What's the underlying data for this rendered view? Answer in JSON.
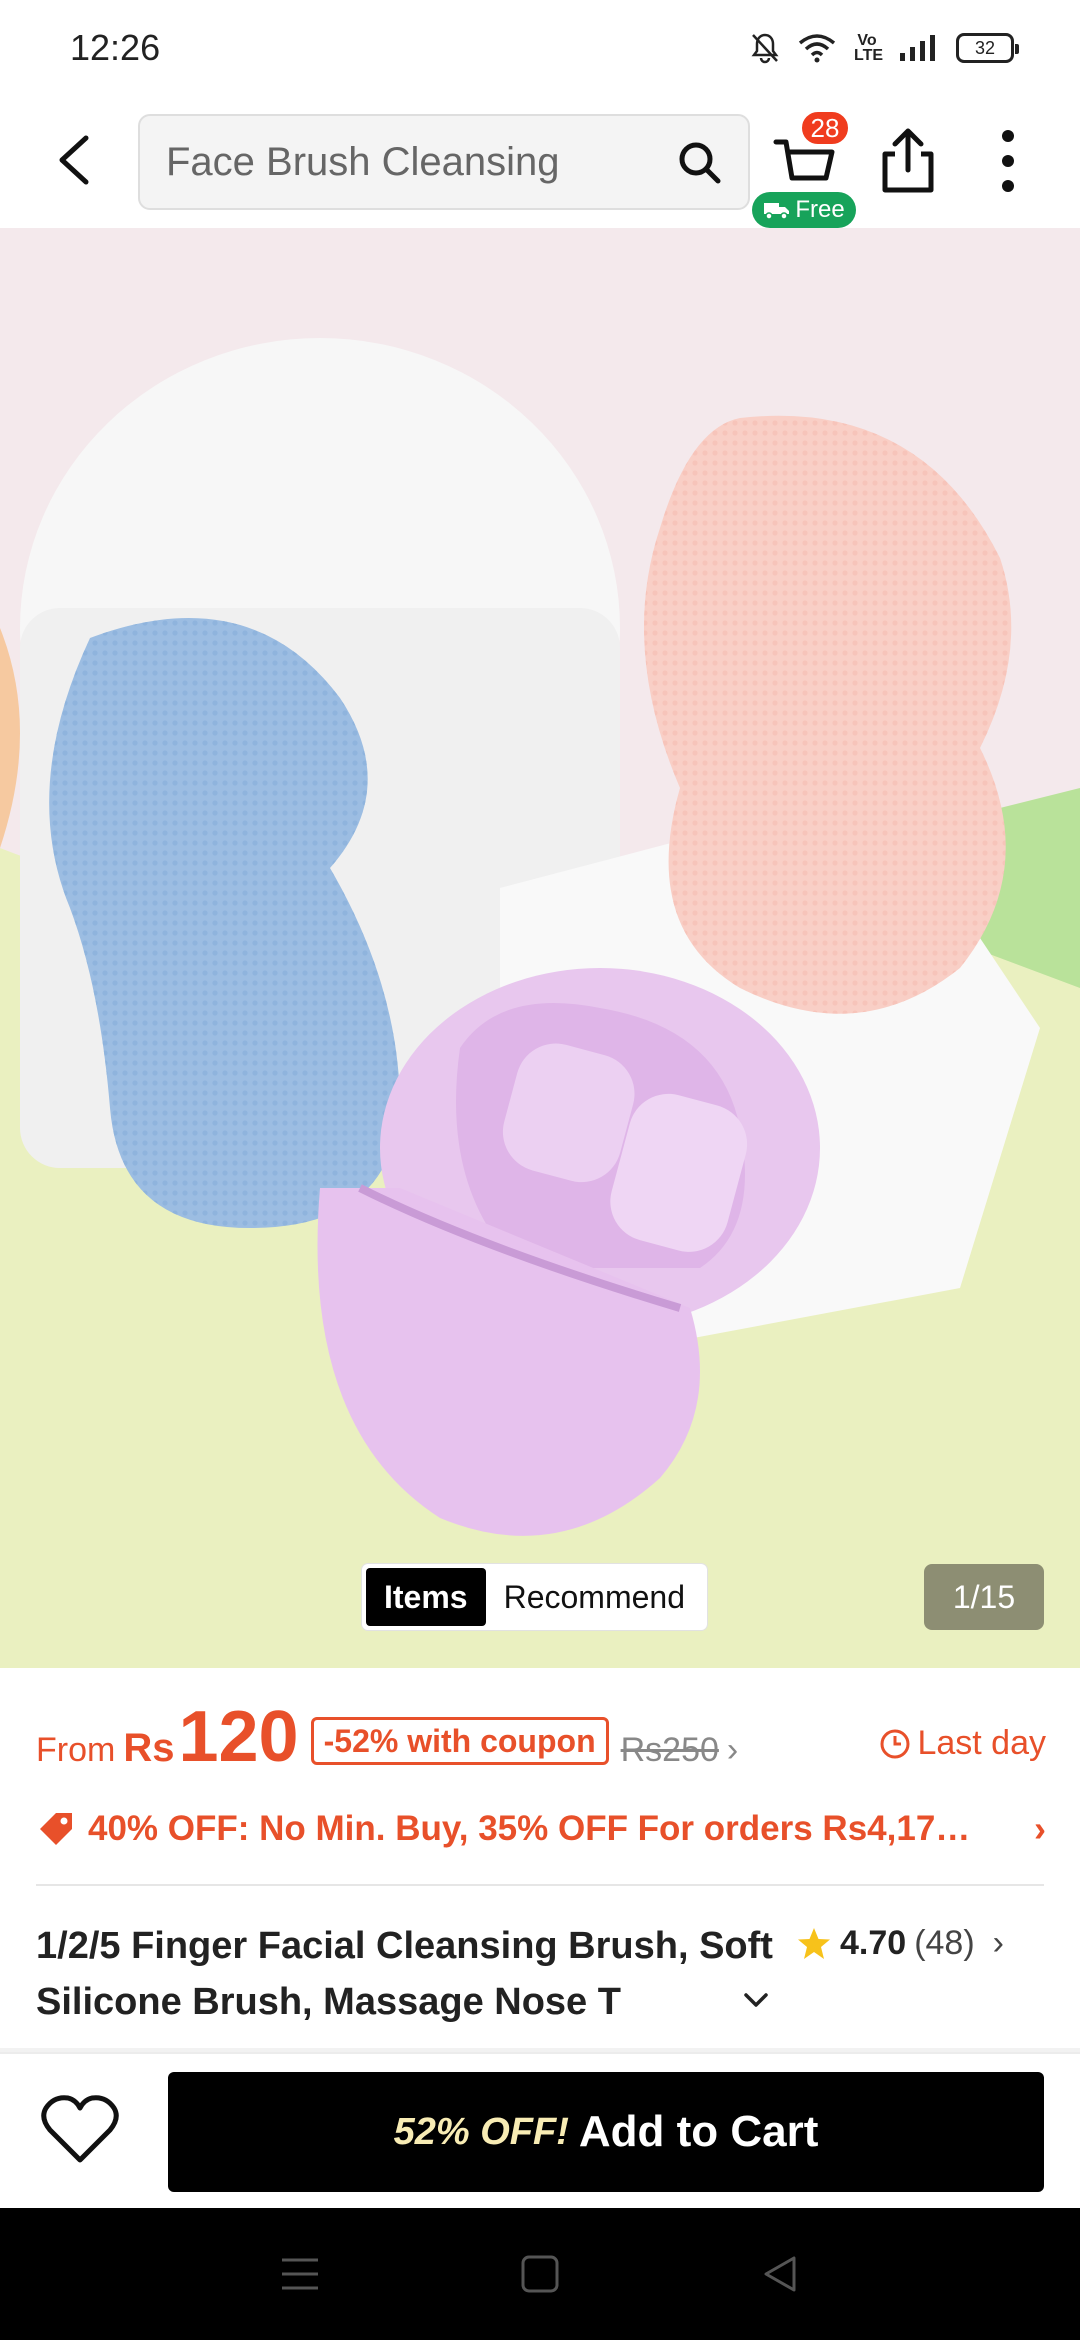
{
  "status_bar": {
    "time": "12:26",
    "network": "Vo LTE",
    "battery": "32"
  },
  "header": {
    "search_text": "Face Brush Cleansing",
    "cart_count": "28",
    "cart_free_label": "Free"
  },
  "hero": {
    "tab_items": "Items",
    "tab_recommend": "Recommend",
    "counter": "1/15"
  },
  "price": {
    "from_label": "From",
    "currency": "Rs",
    "value": "120",
    "coupon": "-52% with coupon",
    "original": "Rs250",
    "last_day": "Last day"
  },
  "promo": {
    "text": "40% OFF: No Min. Buy,  35% OFF For orders Rs4,17…"
  },
  "product": {
    "title": "1/2/5 Finger Facial Cleansing Brush, Soft Silicone Brush, Massage Nose T",
    "rating": "4.70",
    "review_count": "(48)"
  },
  "action_bar": {
    "discount": "52% OFF!",
    "add_to_cart": "Add to Cart"
  },
  "colors": {
    "accent_orange": "#e8502a",
    "free_green": "#17a35a",
    "badge_red": "#f03c1e",
    "star_yellow": "#f7c21b"
  },
  "icons": [
    "back-arrow-icon",
    "search-icon",
    "cart-icon",
    "truck-icon",
    "share-icon",
    "more-icon",
    "clock-icon",
    "price-tag-icon",
    "star-icon",
    "heart-icon",
    "menu-icon",
    "home-square-icon",
    "back-triangle-icon"
  ]
}
